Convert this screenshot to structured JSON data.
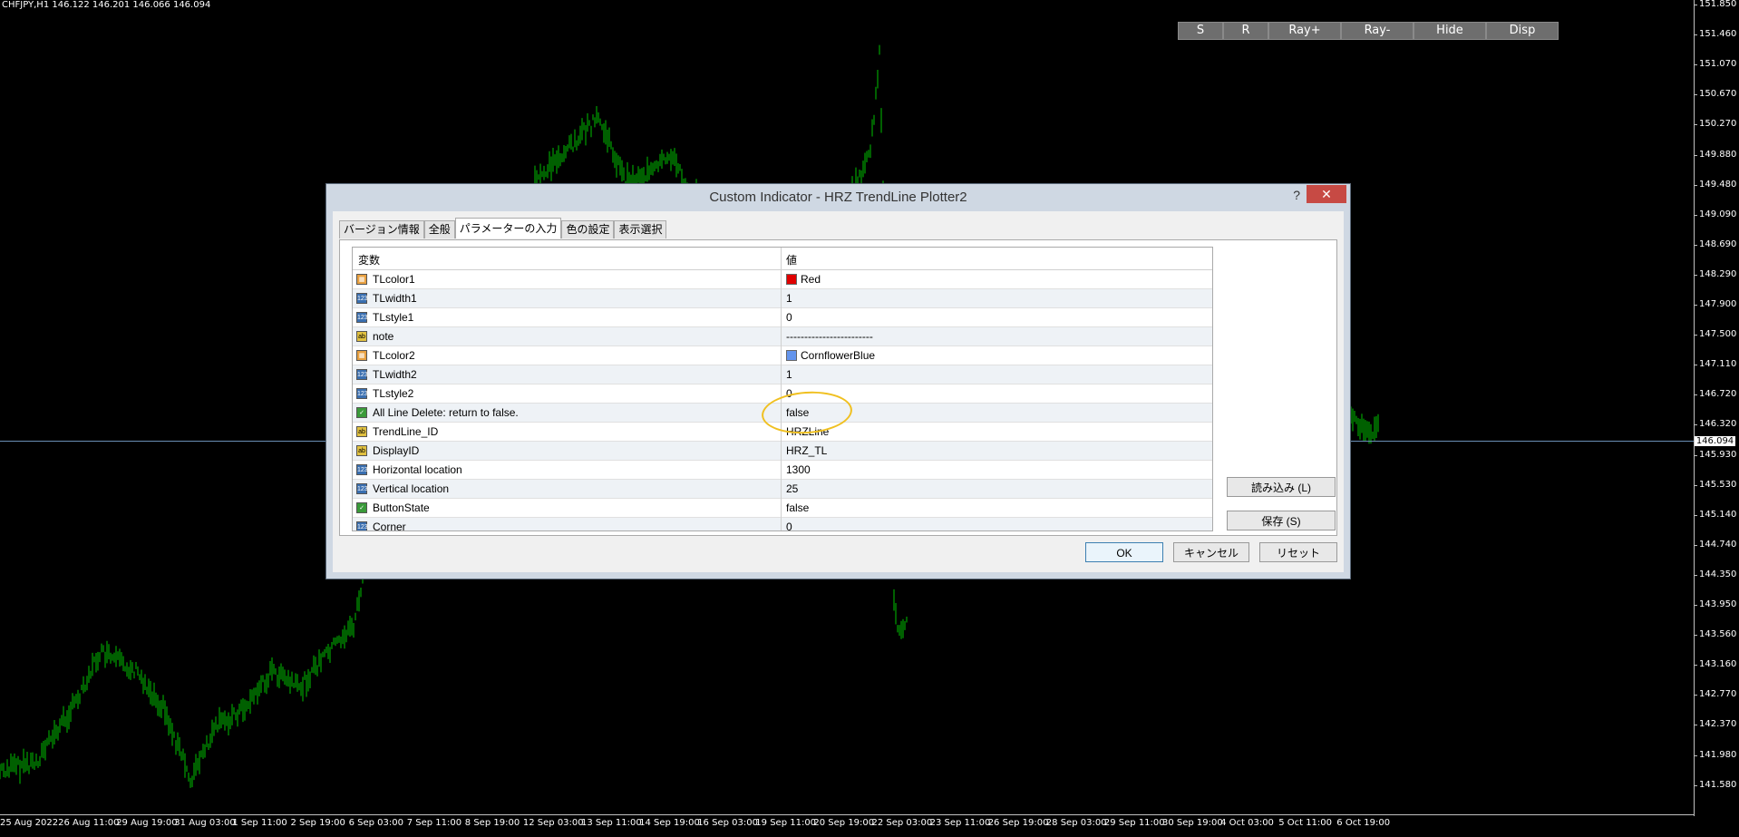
{
  "chart": {
    "ticker": "CHFJPY,H1  146.122 146.201 146.066 146.094",
    "current_price": "146.094",
    "price_labels": [
      "151.850",
      "151.460",
      "151.070",
      "150.670",
      "150.270",
      "149.880",
      "149.480",
      "149.090",
      "148.690",
      "148.290",
      "147.900",
      "147.500",
      "147.110",
      "146.720",
      "146.320",
      "145.930",
      "145.530",
      "145.140",
      "144.740",
      "144.350",
      "143.950",
      "143.560",
      "143.160",
      "142.770",
      "142.370",
      "141.980",
      "141.580"
    ],
    "time_labels": [
      "25 Aug 2022",
      "26 Aug 11:00",
      "29 Aug 19:00",
      "31 Aug 03:00",
      "1 Sep 11:00",
      "2 Sep 19:00",
      "6 Sep 03:00",
      "7 Sep 11:00",
      "8 Sep 19:00",
      "12 Sep 03:00",
      "13 Sep 11:00",
      "14 Sep 19:00",
      "16 Sep 03:00",
      "19 Sep 11:00",
      "20 Sep 19:00",
      "22 Sep 03:00",
      "23 Sep 11:00",
      "26 Sep 19:00",
      "28 Sep 03:00",
      "29 Sep 11:00",
      "30 Sep 19:00",
      "4 Oct 03:00",
      "5 Oct 11:00",
      "6 Oct 19:00"
    ],
    "candle_color": "#00c000"
  },
  "indicator_buttons": [
    "S",
    "R",
    "Ray+",
    "Ray-",
    "Hide",
    "Disp"
  ],
  "dialog": {
    "title": "Custom Indicator - HRZ TrendLine Plotter2",
    "help": "?",
    "close": "✕",
    "tabs": [
      "バージョン情報",
      "全般",
      "パラメーターの入力",
      "色の設定",
      "表示選択"
    ],
    "active_tab": 2,
    "grid_headers": {
      "name": "変数",
      "value": "値"
    },
    "params": [
      {
        "icon": "color",
        "name": "TLcolor1",
        "value": "Red",
        "swatch": "#e00000"
      },
      {
        "icon": "num",
        "name": "TLwidth1",
        "value": "1"
      },
      {
        "icon": "num",
        "name": "TLstyle1",
        "value": "0"
      },
      {
        "icon": "str",
        "name": "note",
        "value": "------------------------"
      },
      {
        "icon": "color",
        "name": "TLcolor2",
        "value": "CornflowerBlue",
        "swatch": "#6495ed"
      },
      {
        "icon": "num",
        "name": "TLwidth2",
        "value": "1"
      },
      {
        "icon": "num",
        "name": "TLstyle2",
        "value": "0"
      },
      {
        "icon": "bool",
        "name": "All Line Delete: return to false.",
        "value": "false"
      },
      {
        "icon": "str",
        "name": "TrendLine_ID",
        "value": "HRZLine"
      },
      {
        "icon": "str",
        "name": "DisplayID",
        "value": "HRZ_TL"
      },
      {
        "icon": "num",
        "name": "Horizontal location",
        "value": "1300"
      },
      {
        "icon": "num",
        "name": "Vertical location",
        "value": "25"
      },
      {
        "icon": "bool",
        "name": "ButtonState",
        "value": "false"
      },
      {
        "icon": "num",
        "name": "Corner",
        "value": "0"
      }
    ],
    "load_button": "読み込み (L)",
    "save_button": "保存 (S)",
    "ok_button": "OK",
    "cancel_button": "キャンセル",
    "reset_button": "リセット"
  }
}
